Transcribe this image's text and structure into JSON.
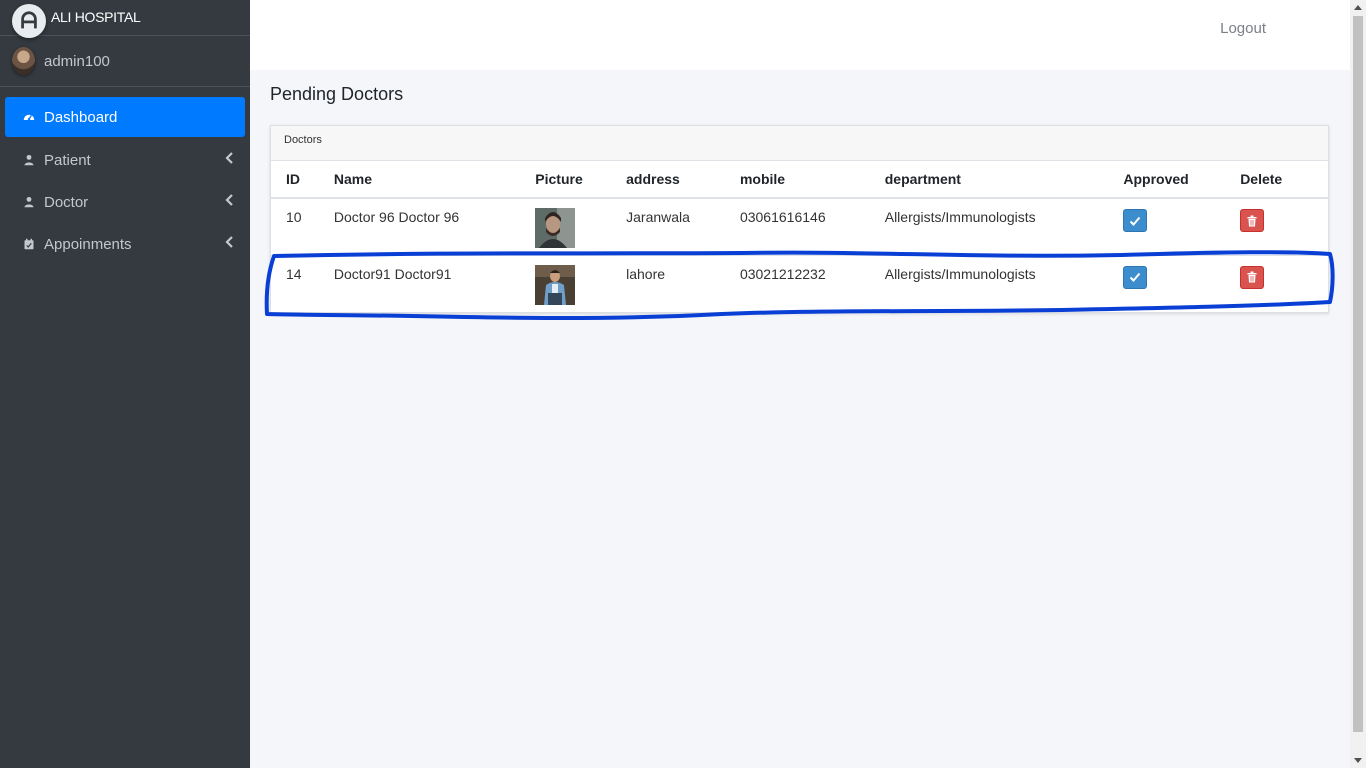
{
  "app": {
    "brand": "ALI HOSPITAL"
  },
  "user": {
    "name": "admin100"
  },
  "sidebar": {
    "items": [
      {
        "label": "Dashboard",
        "icon": "gauge-icon",
        "active": true
      },
      {
        "label": "Patient",
        "icon": "user-icon"
      },
      {
        "label": "Doctor",
        "icon": "user-icon"
      },
      {
        "label": "Appoinments",
        "icon": "calendar-check-icon"
      }
    ]
  },
  "topbar": {
    "logout_label": "Logout"
  },
  "page": {
    "title": "Pending Doctors"
  },
  "card": {
    "header": "Doctors"
  },
  "table": {
    "headers": [
      "ID",
      "Name",
      "Picture",
      "address",
      "mobile",
      "department",
      "Approved",
      "Delete"
    ],
    "rows": [
      {
        "id": "10",
        "name": "Doctor 96 Doctor 96",
        "address": "Jaranwala",
        "mobile": "03061616146",
        "department": "Allergists/Immunologists",
        "picture_icon": "doctor-photo-thumbnail"
      },
      {
        "id": "14",
        "name": "Doctor91 Doctor91",
        "address": "lahore",
        "mobile": "03021212232",
        "department": "Allergists/Immunologists",
        "picture_icon": "doctor-photo-thumbnail"
      }
    ]
  },
  "colors": {
    "sidebar": "#343a40",
    "accent": "#007bff",
    "approve": "#3c8dce",
    "delete": "#d9534f",
    "annotation": "#0a3fd6"
  }
}
